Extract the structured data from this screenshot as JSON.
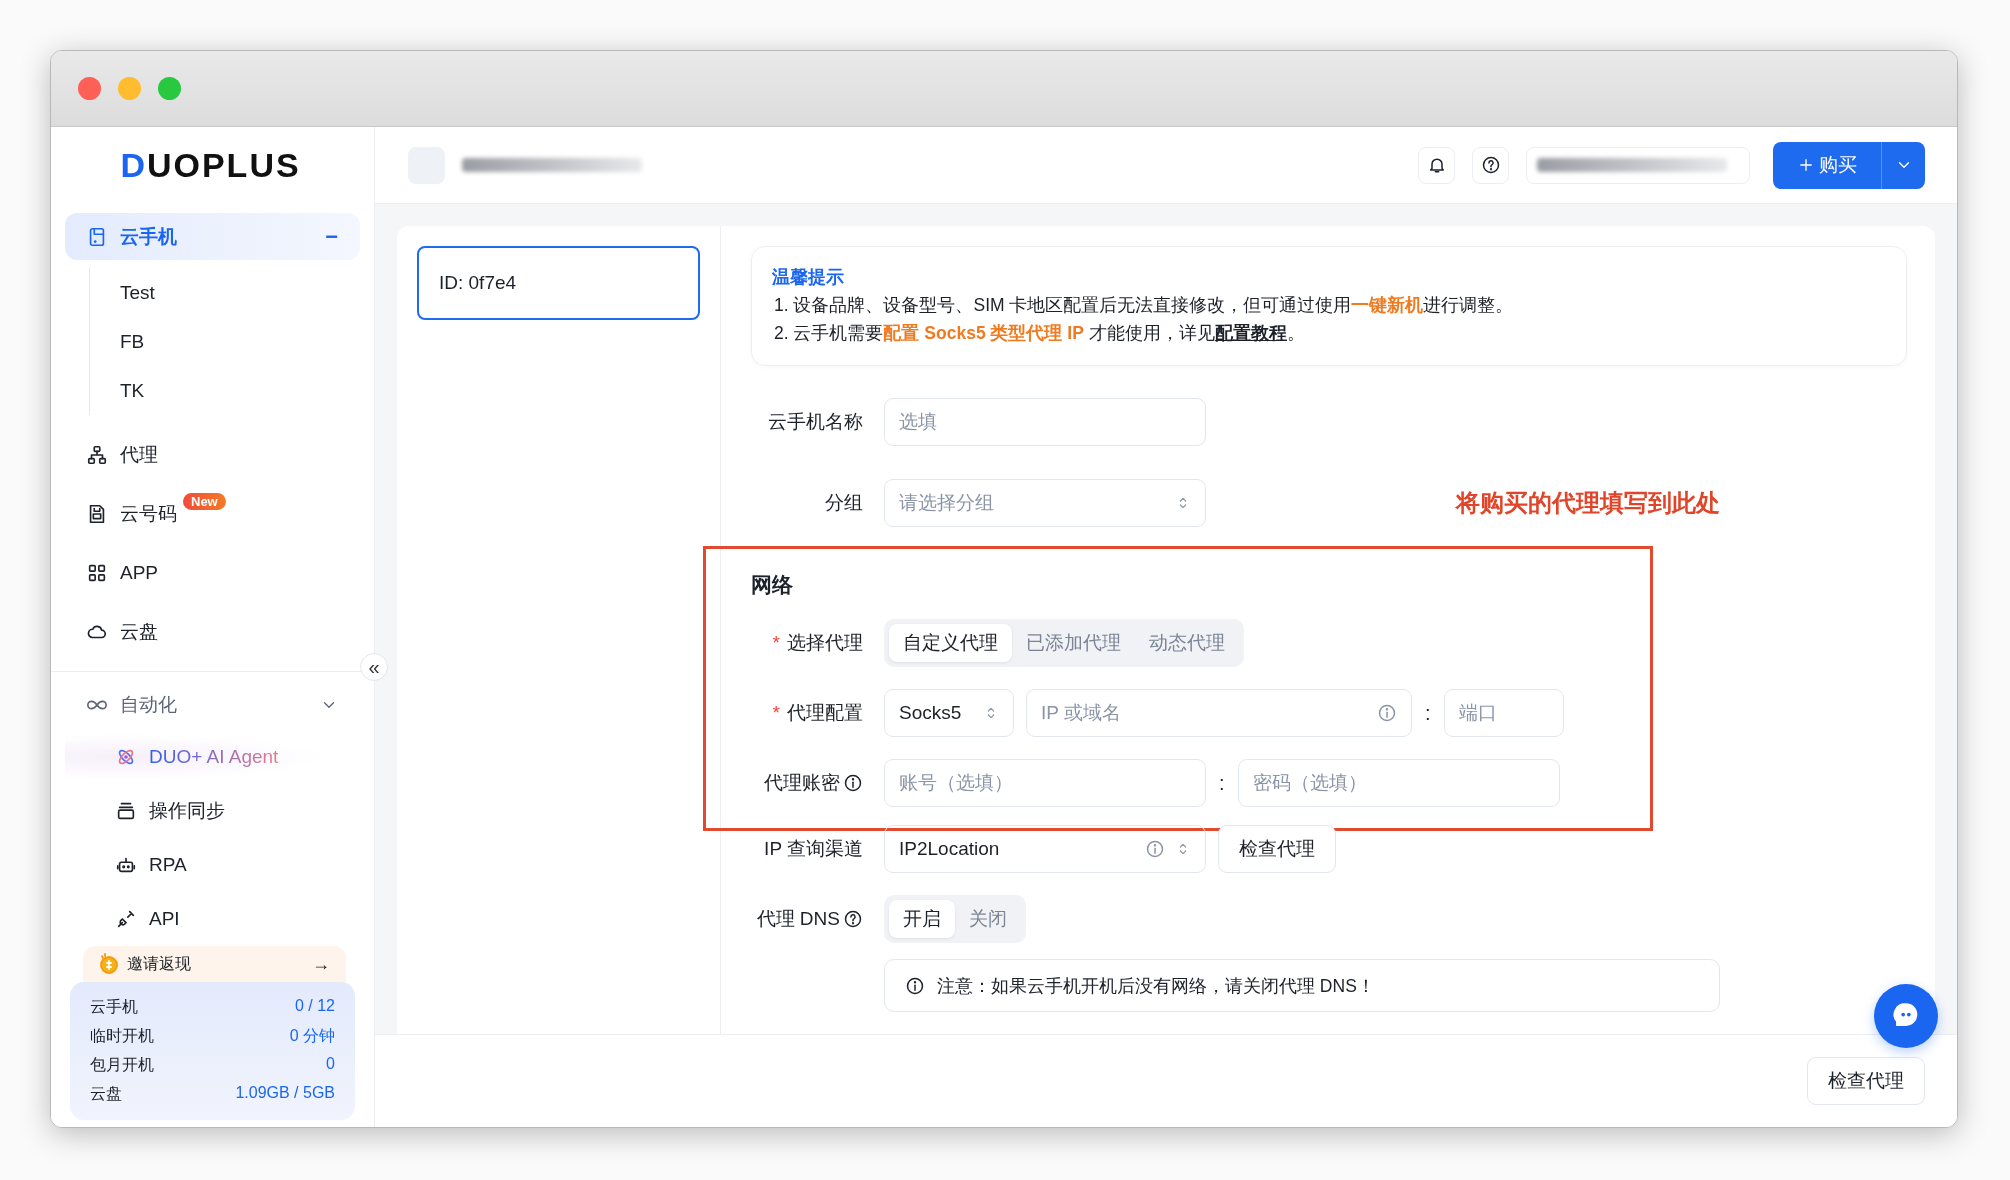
{
  "sidebar": {
    "logo": "DUOPLUS",
    "nav": [
      {
        "label": "云手机",
        "selected": true,
        "expanded": true,
        "toggle": "−",
        "children": [
          {
            "label": "Test"
          },
          {
            "label": "FB"
          },
          {
            "label": "TK"
          }
        ]
      },
      {
        "label": "代理",
        "selected": false
      },
      {
        "label": "云号码",
        "selected": false,
        "badge": "New"
      },
      {
        "label": "APP",
        "selected": false
      },
      {
        "label": "云盘",
        "selected": false
      }
    ],
    "collapse": "«",
    "automation": {
      "label": "自动化",
      "items": [
        {
          "label": "DUO+ AI Agent",
          "kind": "ai"
        },
        {
          "label": "操作同步",
          "kind": "plain"
        },
        {
          "label": "RPA",
          "kind": "plain"
        },
        {
          "label": "API",
          "kind": "plain"
        }
      ]
    },
    "invite": {
      "label": "邀请返现",
      "arrow": "→"
    },
    "stats": [
      {
        "label": "云手机",
        "value": "0 / 12"
      },
      {
        "label": "临时开机",
        "value": "0 分钟"
      },
      {
        "label": "包月开机",
        "value": "0"
      },
      {
        "label": "云盘",
        "value": "1.09GB / 5GB"
      }
    ]
  },
  "header": {
    "buy_button": {
      "label": "购买"
    }
  },
  "device": {
    "id": "ID: 0f7e4",
    "selected": true
  },
  "notice": {
    "title": "温馨提示",
    "lines": [
      [
        {
          "kind": "plain",
          "text": "1. 设备品牌、设备型号、SIM 卡地区配置后无法直接修改，但可通过使用"
        },
        {
          "kind": "highlight",
          "text": "一键新机"
        },
        {
          "kind": "plain",
          "text": "进行调整。"
        }
      ],
      [
        {
          "kind": "plain",
          "text": "2. 云手机需要"
        },
        {
          "kind": "highlight",
          "text": "配置 Socks5 类型代理 IP"
        },
        {
          "kind": "plain",
          "text": " 才能使用，详见"
        },
        {
          "kind": "link",
          "text": "配置教程"
        },
        {
          "kind": "plain",
          "text": "。"
        }
      ]
    ]
  },
  "form": {
    "rows": [
      {
        "kind": "text",
        "label": "云手机名称",
        "placeholder": "选填"
      },
      {
        "kind": "select",
        "label": "分组",
        "placeholder": "请选择分组"
      }
    ],
    "annotation": "将购买的代理填写到此处"
  },
  "network": {
    "title": "网络",
    "rows": [
      {
        "kind": "segmented",
        "marker": "*",
        "label": "选择代理",
        "options": [
          {
            "label": "自定义代理",
            "selected": true
          },
          {
            "label": "已添加代理",
            "selected": false
          },
          {
            "label": "动态代理",
            "selected": false
          }
        ]
      },
      {
        "kind": "proxy",
        "marker": "*",
        "label": "代理配置",
        "protocol": "Socks5",
        "host_placeholder": "IP 或域名",
        "separator": ":",
        "port_placeholder": "端口"
      },
      {
        "kind": "credentials",
        "label": "代理账密",
        "user_placeholder": "账号（选填）",
        "separator": ":",
        "password_placeholder": "密码（选填）"
      }
    ],
    "after": [
      {
        "kind": "lookup",
        "label": "IP 查询渠道",
        "value": "IP2Location",
        "button": "检查代理"
      },
      {
        "kind": "toggle",
        "label": "代理 DNS",
        "options": [
          {
            "label": "开启",
            "selected": true
          },
          {
            "label": "关闭",
            "selected": false
          }
        ]
      },
      {
        "kind": "note",
        "text": "注意：如果云手机开机后没有网络，请关闭代理 DNS！"
      }
    ]
  },
  "footer": {
    "button": "检查代理"
  }
}
